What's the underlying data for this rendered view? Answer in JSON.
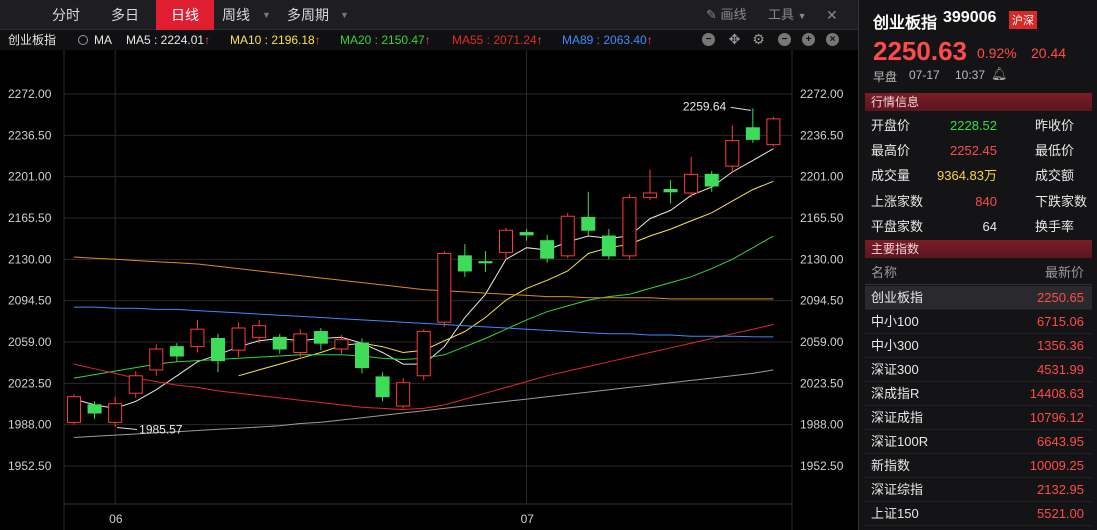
{
  "toolbar": {
    "tabs": [
      {
        "label": "分时"
      },
      {
        "label": "多日"
      },
      {
        "label": "日线"
      },
      {
        "label": "周线"
      },
      {
        "label": "多周期"
      }
    ],
    "draw_label": "画线",
    "tools_label": "工具"
  },
  "ma_bar": {
    "stock": "创业板指",
    "ma_label": "MA",
    "items": [
      {
        "text": "MA5 : 2224.01",
        "color": "#e8e8e8"
      },
      {
        "text": "MA10 : 2196.18",
        "color": "#f5e44a"
      },
      {
        "text": "MA20 : 2150.47",
        "color": "#36d436"
      },
      {
        "text": "MA55 : 2071.24",
        "color": "#e02a2a"
      },
      {
        "text": "MA89 : 2063.40",
        "color": "#3d8bff"
      }
    ],
    "arrow": "↑"
  },
  "panel": {
    "name": "创业板指",
    "code": "399006",
    "market_badge": "沪深",
    "price": "2250.63",
    "change_pct": "0.92%",
    "change": "20.44",
    "session": "早盘",
    "date": "07-17",
    "time": "10:37",
    "quote_header": "行情信息",
    "quotes": [
      {
        "k": "开盘价",
        "v": "2228.52",
        "color": "#2ddf4b",
        "k2": "昨收价"
      },
      {
        "k": "最高价",
        "v": "2252.45",
        "color": "#ff4a4a",
        "k2": "最低价"
      },
      {
        "k": "成交量",
        "v": "9364.83万",
        "color": "#f5d442",
        "k2": "成交额"
      },
      {
        "k": "上涨家数",
        "v": "840",
        "color": "#ff4a4a",
        "k2": "下跌家数"
      },
      {
        "k": "平盘家数",
        "v": "64",
        "color": "#e8e8e8",
        "k2": "换手率"
      }
    ],
    "index_header": "主要指数",
    "index_cols": {
      "name": "名称",
      "price": "最新价"
    },
    "indices": [
      {
        "name": "创业板指",
        "price": "2250.65"
      },
      {
        "name": "中小100",
        "price": "6715.06"
      },
      {
        "name": "中小300",
        "price": "1356.36"
      },
      {
        "name": "深证300",
        "price": "4531.99"
      },
      {
        "name": "深成指R",
        "price": "14408.63"
      },
      {
        "name": "深证成指",
        "price": "10796.12"
      },
      {
        "name": "深证100R",
        "price": "6643.95"
      },
      {
        "name": "新指数",
        "price": "10009.25"
      },
      {
        "name": "深证综指",
        "price": "2132.95"
      },
      {
        "name": "上证150",
        "price": "5521.00"
      }
    ]
  },
  "chart_data": {
    "type": "candlestick",
    "y_ticks": [
      "2272.00",
      "2236.50",
      "2201.00",
      "2165.50",
      "2130.00",
      "2094.50",
      "2059.00",
      "2023.50",
      "1988.00",
      "1952.50"
    ],
    "ylim": [
      1945,
      2295
    ],
    "x_labels": [
      {
        "label": "06",
        "index": 2
      },
      {
        "label": "07",
        "index": 22
      }
    ],
    "high_annotation": {
      "label": "2259.64",
      "index": 33,
      "value": 2259.64
    },
    "low_annotation": {
      "label": "1985.57",
      "index": 2,
      "value": 1985.57
    },
    "candles": [
      {
        "o": 1990,
        "c": 2012,
        "h": 2014,
        "l": 1988
      },
      {
        "o": 2005,
        "c": 1998,
        "h": 2008,
        "l": 1993
      },
      {
        "o": 1990,
        "c": 2006,
        "h": 2012,
        "l": 1986
      },
      {
        "o": 2015,
        "c": 2030,
        "h": 2034,
        "l": 2011
      },
      {
        "o": 2035,
        "c": 2053,
        "h": 2057,
        "l": 2030
      },
      {
        "o": 2055,
        "c": 2047,
        "h": 2058,
        "l": 2042
      },
      {
        "o": 2055,
        "c": 2070,
        "h": 2078,
        "l": 2050
      },
      {
        "o": 2062,
        "c": 2043,
        "h": 2066,
        "l": 2033
      },
      {
        "o": 2052,
        "c": 2071,
        "h": 2076,
        "l": 2046
      },
      {
        "o": 2063,
        "c": 2073,
        "h": 2078,
        "l": 2058
      },
      {
        "o": 2063,
        "c": 2053,
        "h": 2066,
        "l": 2049
      },
      {
        "o": 2050,
        "c": 2066,
        "h": 2070,
        "l": 2046
      },
      {
        "o": 2068,
        "c": 2058,
        "h": 2071,
        "l": 2052
      },
      {
        "o": 2053,
        "c": 2061,
        "h": 2065,
        "l": 2049
      },
      {
        "o": 2058,
        "c": 2037,
        "h": 2062,
        "l": 2032
      },
      {
        "o": 2029,
        "c": 2012,
        "h": 2033,
        "l": 2008
      },
      {
        "o": 2004,
        "c": 2024,
        "h": 2028,
        "l": 2002
      },
      {
        "o": 2030,
        "c": 2068,
        "h": 2070,
        "l": 2026
      },
      {
        "o": 2076,
        "c": 2135,
        "h": 2137,
        "l": 2072
      },
      {
        "o": 2133,
        "c": 2120,
        "h": 2143,
        "l": 2115
      },
      {
        "o": 2128,
        "c": 2127,
        "h": 2137,
        "l": 2119
      },
      {
        "o": 2136,
        "c": 2155,
        "h": 2157,
        "l": 2130
      },
      {
        "o": 2153,
        "c": 2151,
        "h": 2156,
        "l": 2146
      },
      {
        "o": 2146,
        "c": 2131,
        "h": 2151,
        "l": 2127
      },
      {
        "o": 2133,
        "c": 2167,
        "h": 2170,
        "l": 2131
      },
      {
        "o": 2166,
        "c": 2155,
        "h": 2188,
        "l": 2150
      },
      {
        "o": 2150,
        "c": 2133,
        "h": 2156,
        "l": 2130
      },
      {
        "o": 2133,
        "c": 2183,
        "h": 2186,
        "l": 2130
      },
      {
        "o": 2183,
        "c": 2187,
        "h": 2207,
        "l": 2181
      },
      {
        "o": 2190,
        "c": 2188,
        "h": 2198,
        "l": 2178
      },
      {
        "o": 2187,
        "c": 2203,
        "h": 2218,
        "l": 2183
      },
      {
        "o": 2203,
        "c": 2193,
        "h": 2206,
        "l": 2188
      },
      {
        "o": 2210,
        "c": 2232,
        "h": 2245,
        "l": 2205
      },
      {
        "o": 2243,
        "c": 2233,
        "h": 2259.64,
        "l": 2230
      },
      {
        "o": 2228.52,
        "c": 2250.63,
        "h": 2252.45,
        "l": 2227
      }
    ],
    "ma_lines": [
      {
        "name": "MA5",
        "color": "#e8e8e8",
        "values": [
          2010,
          2005,
          2002,
          2008,
          2018,
          2030,
          2042,
          2048,
          2055,
          2060,
          2062,
          2060,
          2062,
          2063,
          2058,
          2050,
          2040,
          2040,
          2055,
          2080,
          2100,
          2130,
          2140,
          2138,
          2145,
          2150,
          2148,
          2150,
          2165,
          2172,
          2185,
          2192,
          2205,
          2215,
          2225
        ]
      },
      {
        "name": "MA10",
        "color": "#f5e44a",
        "values": [
          null,
          null,
          null,
          null,
          null,
          null,
          null,
          null,
          2030,
          2035,
          2040,
          2045,
          2050,
          2056,
          2058,
          2055,
          2050,
          2052,
          2060,
          2068,
          2080,
          2095,
          2105,
          2112,
          2120,
          2135,
          2140,
          2143,
          2150,
          2156,
          2163,
          2170,
          2180,
          2190,
          2197
        ]
      },
      {
        "name": "MA20",
        "color": "#36d436",
        "values": [
          2028,
          2031,
          2034,
          2037,
          2040,
          2042,
          2043,
          2044,
          2045,
          2046,
          2047,
          2048,
          2048,
          2048,
          2047,
          2045,
          2044,
          2045,
          2048,
          2055,
          2062,
          2070,
          2078,
          2085,
          2090,
          2095,
          2098,
          2100,
          2105,
          2110,
          2115,
          2122,
          2130,
          2140,
          2150
        ]
      },
      {
        "name": "MA55",
        "color": "#e02a2a",
        "values": [
          2040,
          2036,
          2032,
          2028,
          2025,
          2022,
          2020,
          2017,
          2015,
          2013,
          2011,
          2009,
          2007,
          2005,
          2003,
          2002,
          2001,
          2002,
          2005,
          2010,
          2015,
          2020,
          2025,
          2030,
          2034,
          2038,
          2042,
          2046,
          2050,
          2054,
          2058,
          2062,
          2066,
          2070,
          2074
        ]
      },
      {
        "name": "MA89",
        "color": "#3d8bff",
        "values": [
          2089,
          2089,
          2088,
          2088,
          2087,
          2087,
          2086,
          2085,
          2084,
          2083,
          2082,
          2081,
          2080,
          2079,
          2078,
          2077,
          2076,
          2075,
          2074,
          2073,
          2072,
          2071,
          2070,
          2069,
          2068,
          2067,
          2066,
          2066,
          2065,
          2065,
          2064,
          2064,
          2064,
          2063.5,
          2063.4
        ]
      },
      {
        "name": "MA120",
        "color": "#e08a1e",
        "values": [
          2132,
          2131,
          2130,
          2129,
          2128,
          2127,
          2126,
          2124,
          2122,
          2120,
          2118,
          2116,
          2114,
          2112,
          2110,
          2108,
          2106,
          2104,
          2103,
          2102,
          2101,
          2100,
          2099,
          2098,
          2098,
          2097,
          2097,
          2097,
          2097,
          2096,
          2096,
          2096,
          2096,
          2096,
          2096
        ]
      },
      {
        "name": "MA250",
        "color": "#9c9c9c",
        "values": [
          1977,
          1978,
          1979,
          1980,
          1981,
          1982,
          1983,
          1984,
          1985,
          1986,
          1987,
          1989,
          1990,
          1992,
          1994,
          1996,
          1998,
          2000,
          2002,
          2004,
          2006,
          2008,
          2010,
          2012,
          2014,
          2016,
          2018,
          2020,
          2022,
          2024,
          2026,
          2028,
          2030,
          2032,
          2035
        ]
      }
    ]
  }
}
